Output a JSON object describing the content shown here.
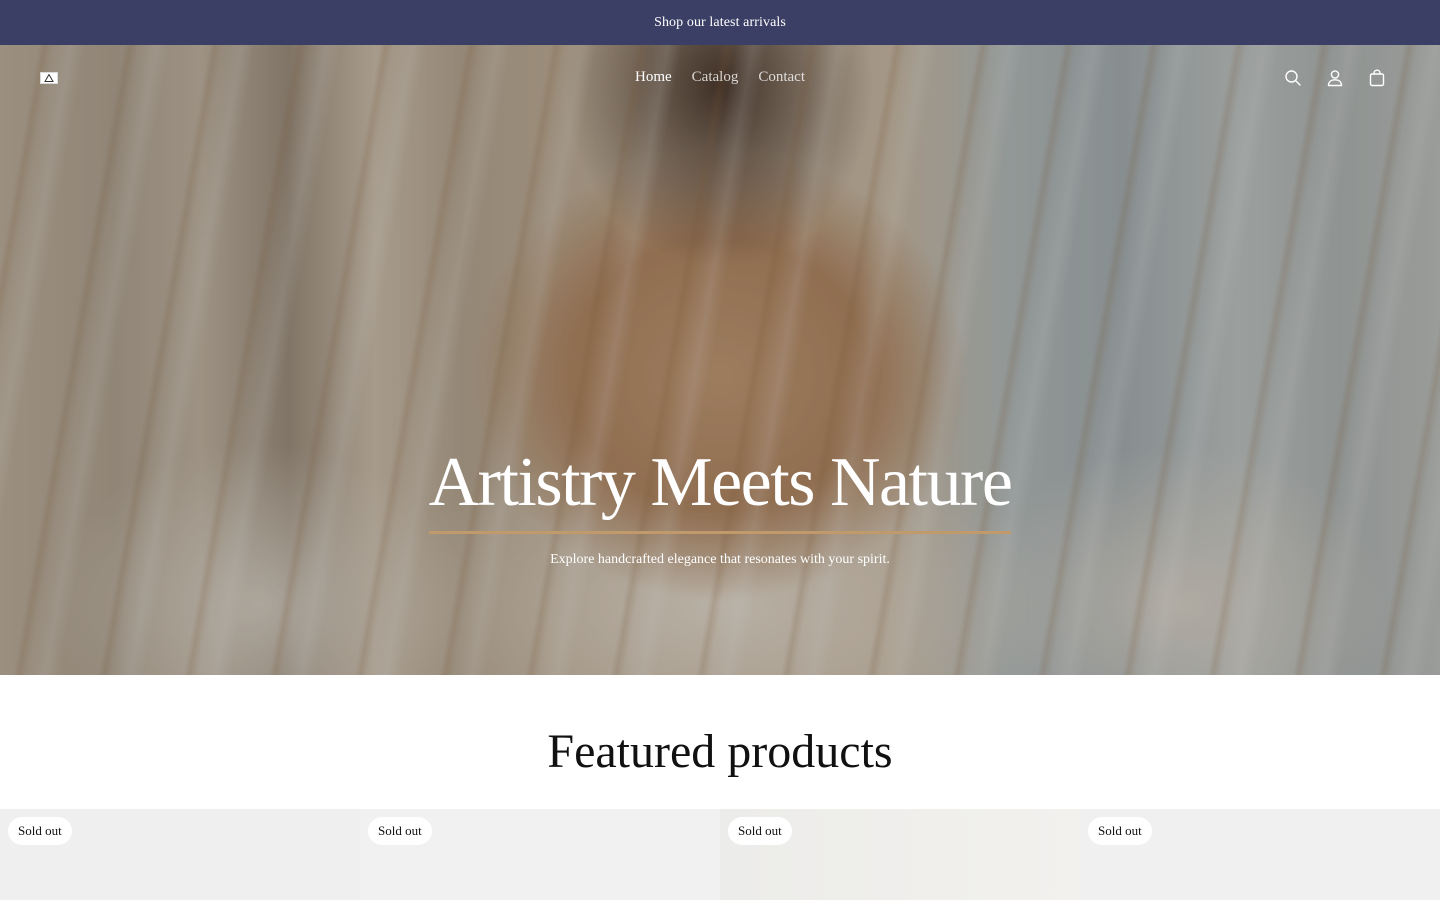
{
  "announcement": {
    "text": "Shop our latest arrivals"
  },
  "header": {
    "nav": [
      {
        "label": "Home",
        "active": true
      },
      {
        "label": "Catalog",
        "active": false
      },
      {
        "label": "Contact",
        "active": false
      }
    ],
    "icons": [
      "search-icon",
      "account-icon",
      "cart-icon"
    ]
  },
  "hero": {
    "title": "Artistry Meets Nature",
    "subtitle": "Explore handcrafted elegance that resonates with your spirit."
  },
  "featured": {
    "title": "Featured products",
    "products": [
      {
        "badge": "Sold out"
      },
      {
        "badge": "Sold out"
      },
      {
        "badge": "Sold out"
      },
      {
        "badge": "Sold out"
      }
    ]
  },
  "colors": {
    "announcement_bg": "#3b3f66",
    "accent_underline": "#c09a6b"
  }
}
